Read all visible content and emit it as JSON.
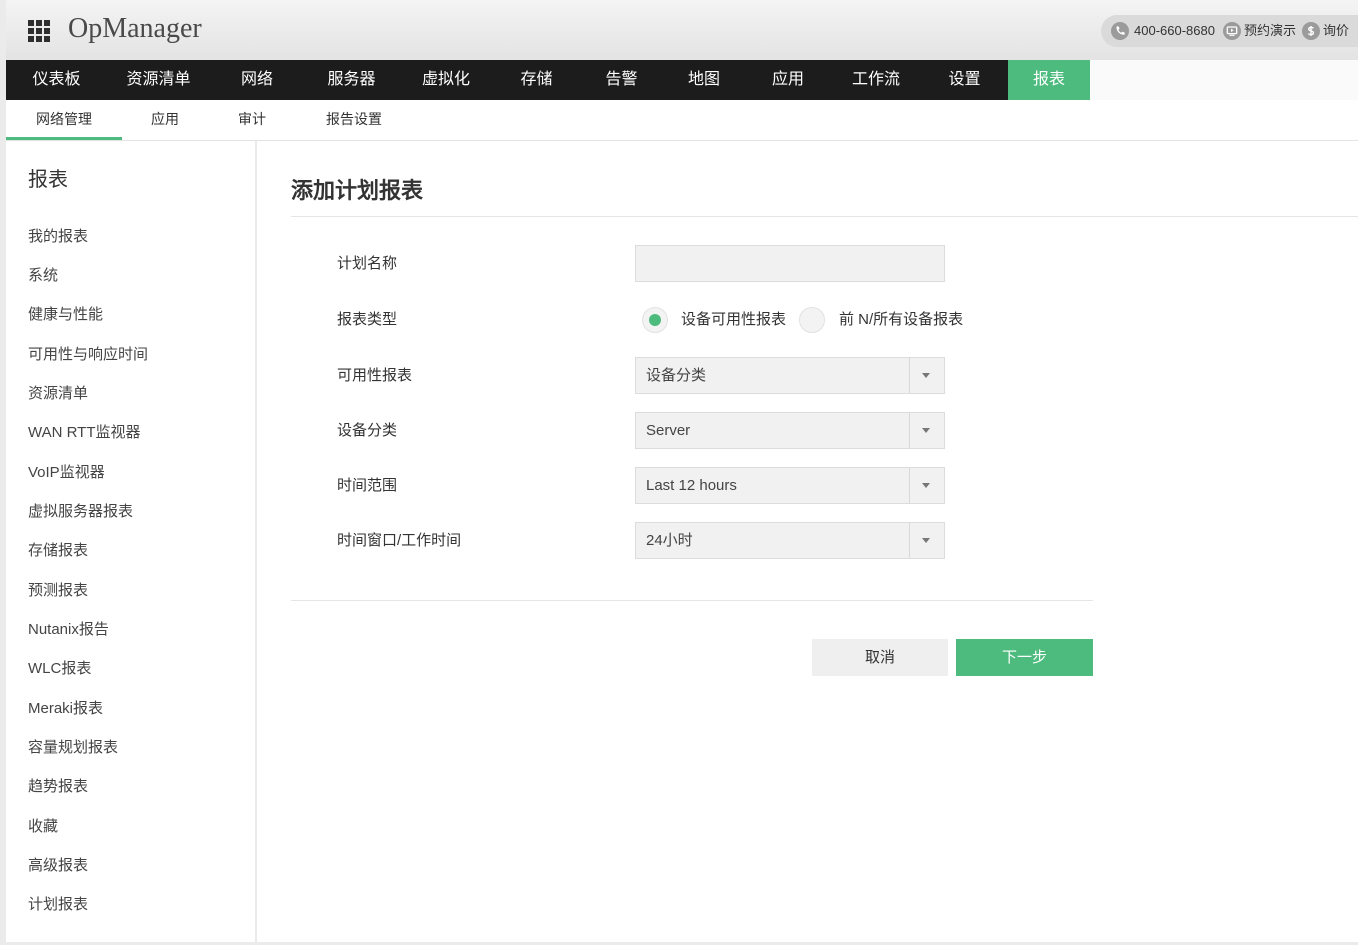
{
  "header": {
    "launcher_icon": "apps-grid-icon",
    "app_name": "OpManager",
    "contacts": [
      {
        "icon": "phone-icon",
        "label": "400-660-8680"
      },
      {
        "icon": "demo-video-icon",
        "label": "预约演示"
      },
      {
        "icon": "dollar-icon",
        "label": "询价"
      }
    ]
  },
  "nav": {
    "items": [
      {
        "label": "仪表板"
      },
      {
        "label": "资源清单"
      },
      {
        "label": "网络"
      },
      {
        "label": "服务器"
      },
      {
        "label": "虚拟化"
      },
      {
        "label": "存储"
      },
      {
        "label": "告警"
      },
      {
        "label": "地图"
      },
      {
        "label": "应用"
      },
      {
        "label": "工作流"
      },
      {
        "label": "设置"
      },
      {
        "label": "报表",
        "active": true
      }
    ]
  },
  "subnav": {
    "items": [
      {
        "label": "网络管理",
        "active": true
      },
      {
        "label": "应用"
      },
      {
        "label": "审计"
      },
      {
        "label": "报告设置"
      }
    ]
  },
  "sidebar": {
    "title": "报表",
    "items": [
      "我的报表",
      "系统",
      "健康与性能",
      "可用性与响应时间",
      "资源清单",
      "WAN RTT监视器",
      "VoIP监视器",
      "虚拟服务器报表",
      "存储报表",
      "预测报表",
      "Nutanix报告",
      "WLC报表",
      "Meraki报表",
      "容量规划报表",
      "趋势报表",
      "收藏",
      "高级报表",
      "计划报表"
    ]
  },
  "form": {
    "title": "添加计划报表",
    "schedule_name": {
      "label": "计划名称"
    },
    "report_type": {
      "label": "报表类型",
      "options": [
        {
          "label": "设备可用性报表",
          "selected": true
        },
        {
          "label": "前 N/所有设备报表",
          "selected": false
        }
      ]
    },
    "availability_report": {
      "label": "可用性报表",
      "value": "设备分类"
    },
    "device_category": {
      "label": "设备分类",
      "value": "Server"
    },
    "time_range": {
      "label": "时间范围",
      "value": "Last 12 hours"
    },
    "time_window": {
      "label": "时间窗口/工作时间",
      "value": "24小时"
    },
    "select_icon": "caret-down-icon",
    "buttons": {
      "cancel": "取消",
      "next": "下一步"
    }
  },
  "colors": {
    "accent": "#4cbb7d",
    "nav_bg": "#1c1c1c"
  }
}
